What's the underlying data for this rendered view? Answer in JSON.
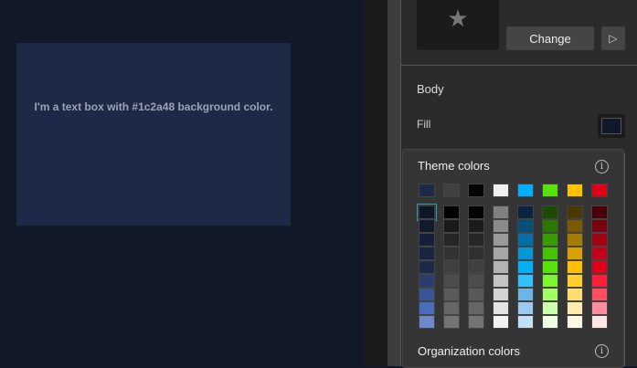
{
  "canvas": {
    "textbox_text": "I'm a text box with #1c2a48 background color.",
    "textbox_color": "#1c2a48"
  },
  "panel": {
    "change_label": "Change",
    "play_icon": "▷",
    "star_icon": "★",
    "section": "Body",
    "fill_label": "Fill",
    "fill_color": "#111827"
  },
  "picker": {
    "theme_title": "Theme colors",
    "org_title": "Organization colors",
    "info_icon": "i",
    "base": [
      "#1c2a48",
      "#404040",
      "#050505",
      "#f0f0f0",
      "#00b0ff",
      "#56e30c",
      "#ffc000",
      "#e0001a"
    ],
    "columns": [
      [
        "#0f1628",
        "#111b30",
        "#151f3a",
        "#182440",
        "#1c2a48",
        "#2b3d6e",
        "#3a5597",
        "#4a6dbf",
        "#6d89c9"
      ],
      [
        "#030303",
        "#1a1a1a",
        "#262626",
        "#333333",
        "#404040",
        "#4d4d4d",
        "#5a5a5a",
        "#666666",
        "#737373"
      ],
      [
        "#050505",
        "#1b1b1b",
        "#262626",
        "#303030",
        "#404040",
        "#4d4d4d",
        "#595959",
        "#666666",
        "#737373"
      ],
      [
        "#808080",
        "#8c8c8c",
        "#999999",
        "#a6a6a6",
        "#b3b3b3",
        "#c4c4c4",
        "#d4d4d4",
        "#e3e3e3",
        "#f2f2f2"
      ],
      [
        "#0b2540",
        "#00507a",
        "#0070a6",
        "#0099d6",
        "#00b0ff",
        "#33c0ff",
        "#70b4e6",
        "#99ccf0",
        "#c2e0f7"
      ],
      [
        "#1b4a00",
        "#2a7a00",
        "#389e00",
        "#45c400",
        "#56e30c",
        "#7ff52e",
        "#a3ff63",
        "#ccffab",
        "#efffe5"
      ],
      [
        "#4a3800",
        "#7a5a00",
        "#a67c00",
        "#d9a100",
        "#ffc000",
        "#ffcf2e",
        "#ffdd70",
        "#ffedb0",
        "#fff8e5"
      ],
      [
        "#4a0008",
        "#7a000f",
        "#a30014",
        "#c40018",
        "#e0001a",
        "#ff1f3a",
        "#ff4d61",
        "#ff8f9c",
        "#ffe5e8"
      ]
    ]
  }
}
